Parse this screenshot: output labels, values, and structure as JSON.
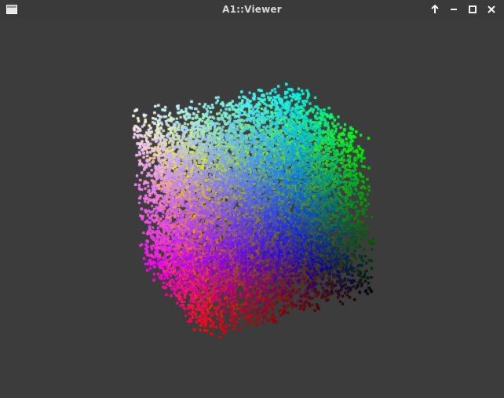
{
  "window": {
    "title": "A1::Viewer",
    "icon": "window-app-icon",
    "controls": [
      "arrow-up-icon",
      "minimize-icon",
      "maximize-icon",
      "close-icon"
    ]
  },
  "viewer": {
    "background": "#3c3c3c",
    "content": "rgb-color-cube-point-cloud",
    "corner_colors": {
      "white": "#ffffff",
      "cyan": "#00ffff",
      "yellow": "#ffff00",
      "green": "#00ff00",
      "magenta": "#ff00ff",
      "blue": "#0000ff",
      "red": "#ff0000",
      "black": "#000000"
    }
  }
}
